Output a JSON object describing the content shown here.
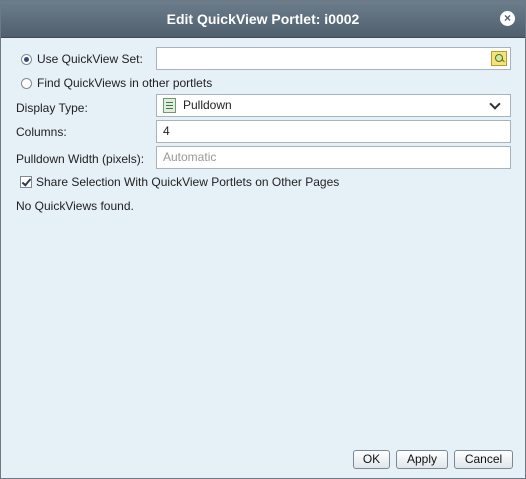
{
  "dialog": {
    "title": "Edit QuickView Portlet: i0002",
    "close_icon": "close-icon"
  },
  "form": {
    "use_set_label": "Use QuickView Set:",
    "use_set_selected": true,
    "use_set_value": "",
    "find_label": "Find QuickViews in other portlets",
    "find_selected": false,
    "display_type_label": "Display Type:",
    "display_type_value": "Pulldown",
    "columns_label": "Columns:",
    "columns_value": "4",
    "pulldown_width_label": "Pulldown Width (pixels):",
    "pulldown_width_placeholder": "Automatic",
    "share_label": "Share Selection With QuickView Portlets on Other Pages",
    "share_checked": true,
    "empty_message": "No QuickViews found."
  },
  "buttons": {
    "ok": "OK",
    "apply": "Apply",
    "cancel": "Cancel"
  }
}
